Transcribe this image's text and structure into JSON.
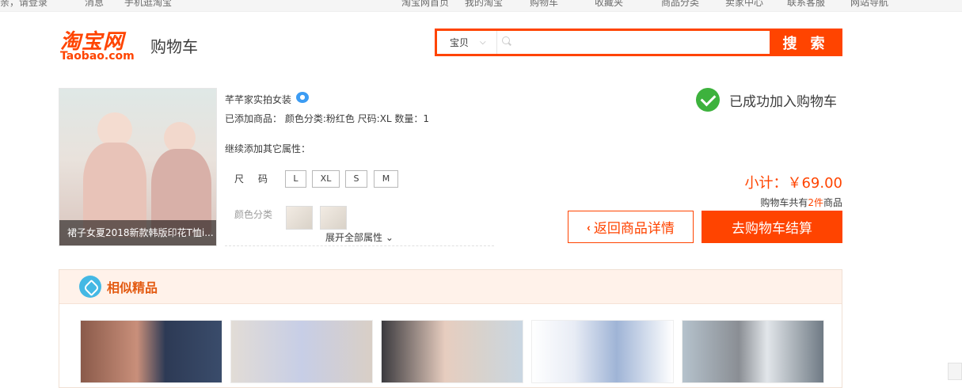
{
  "topbar": {
    "login": "亲，请登录",
    "message": "消息",
    "mobile": "手机逛淘宝",
    "my_taobao": "我的淘宝",
    "cart": "购物车",
    "favorites": "收藏夹",
    "categories": "商品分类",
    "seller_center": "卖家中心",
    "contact": "联系客服",
    "site_nav": "网站导航",
    "taobao_home": "淘宝网首页"
  },
  "header": {
    "logo_cn": "淘宝网",
    "logo_en": "Taobao.com",
    "page_title": "购物车",
    "search": {
      "category": "宝贝",
      "placeholder": "",
      "button": "搜 索"
    }
  },
  "product": {
    "image_caption": "裙子女夏2018新款韩版印花T恤i...",
    "shop_name": "芊芊家实拍女装",
    "added_line": "已添加商品：  颜色分类:粉红色 尺码:XL 数量：1",
    "continue_label": "继续添加其它属性：",
    "size_label": "尺码",
    "sizes": [
      "L",
      "XL",
      "S",
      "M"
    ],
    "color_label": "颜色分类",
    "expand_label": "展开全部属性"
  },
  "result": {
    "success_text": "已成功加入购物车",
    "subtotal": "小计：￥69.00",
    "cart_count_prefix": "购物车共有",
    "cart_count_num": "2件",
    "cart_count_suffix": "商品",
    "back_button": "返回商品详情",
    "checkout_button": "去购物车结算"
  },
  "similar": {
    "title": "相似精品"
  },
  "colors": {
    "accent": "#ff4400",
    "success": "#3db23d",
    "similar_title": "#e35b12"
  }
}
